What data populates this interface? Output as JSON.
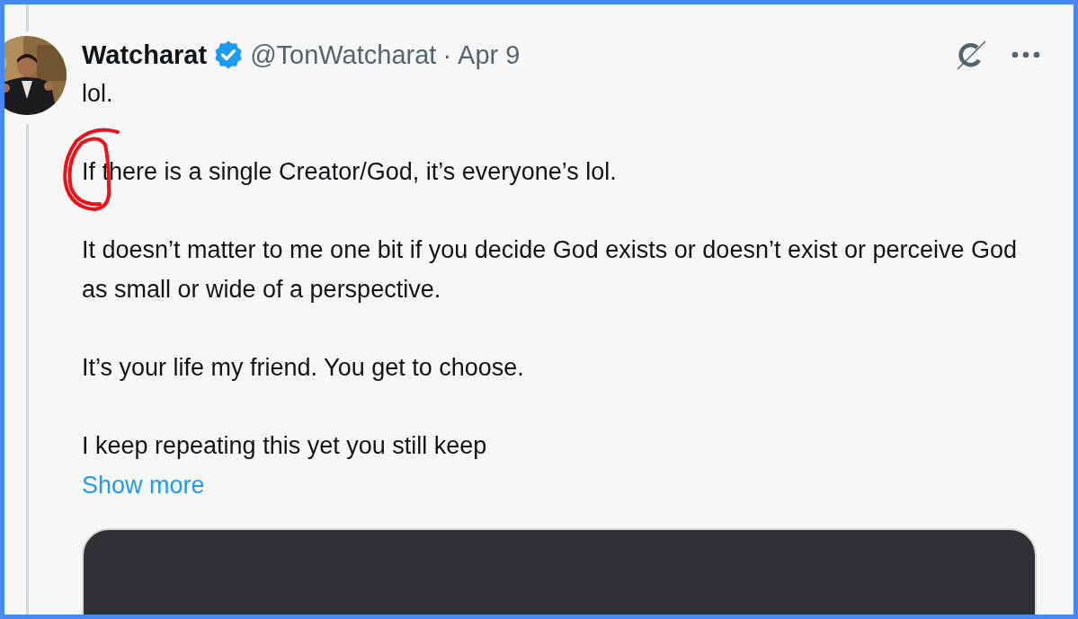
{
  "tweet": {
    "author": {
      "name": "Watcharat",
      "verified": true,
      "handle": "@TonWatcharat",
      "separator": "·",
      "date": "Apr 9"
    },
    "paragraphs": [
      "lol.",
      "If there is a single Creator/God, it’s everyone’s lol.",
      "It doesn’t matter to me one bit if you decide God exists or doesn’t exist or perceive God as small or wide of a perspective.",
      "It’s your life my friend. You get to choose.",
      "I keep repeating this yet you still keep"
    ],
    "show_more": "Show more"
  }
}
